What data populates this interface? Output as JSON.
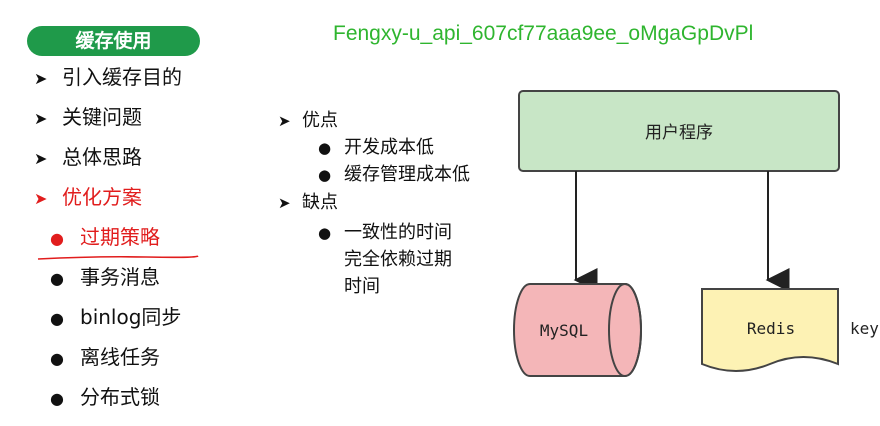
{
  "header": {
    "pill_label": "缓存使用",
    "watermark": "Fengxy-u_api_607cf77aaa9ee_oMgaGpDvPl"
  },
  "menu": {
    "items": [
      {
        "label": "引入缓存目的"
      },
      {
        "label": "关键问题"
      },
      {
        "label": "总体思路"
      },
      {
        "label": "优化方案"
      }
    ],
    "sub_items": [
      {
        "label": "过期策略"
      },
      {
        "label": "事务消息"
      },
      {
        "label": "binlog同步"
      },
      {
        "label": "离线任务"
      },
      {
        "label": "分布式锁"
      }
    ]
  },
  "middle": {
    "pros_title": "优点",
    "pros": [
      "开发成本低",
      "缓存管理成本低"
    ],
    "cons_title": "缺点",
    "cons_lines": [
      "一致性的时间",
      "完全依赖过期",
      "时间"
    ]
  },
  "diagram": {
    "user_box": "用户程序",
    "mysql_label": "MySQL",
    "redis_label": "Redis",
    "redis_side_label": "key"
  },
  "colors": {
    "pill": "#1f9a4a",
    "watermark": "#2fb52f",
    "active": "#e11d1d",
    "user_box_fill": "#c8e6c6",
    "mysql_fill": "#f4b6b8",
    "redis_fill": "#fdf2b4"
  },
  "icons": {
    "menu_marker": "arrow-right-icon",
    "sub_marker": "bullet-icon"
  }
}
